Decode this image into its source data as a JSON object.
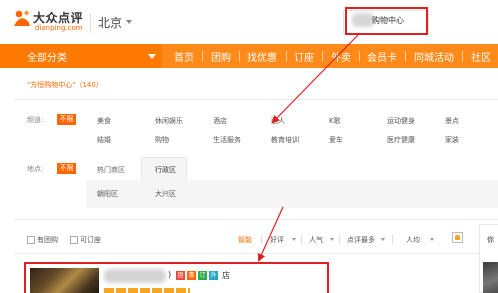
{
  "header": {
    "logo": {
      "name_cn": "大众点评",
      "domain": "dianping.com",
      "icon": "dianping-logo-icon"
    },
    "city": {
      "label": "北京",
      "icon": "chevron-down-icon"
    },
    "search": {
      "value": "购物中心"
    }
  },
  "nav": {
    "all_categories": "全部分类",
    "items": [
      "首页",
      "团购",
      "找优惠",
      "订座",
      "外卖",
      "会员卡",
      "同城活动",
      "社区"
    ]
  },
  "results": {
    "title": "\"方恒购物中心\"（140）"
  },
  "filters": {
    "category": {
      "label": "频道:",
      "all_tag": "不限",
      "row1": [
        "美食",
        "休闲娱乐",
        "酒店",
        "丽人",
        "K歌",
        "运动健身",
        "景点"
      ],
      "row2": [
        "结婚",
        "购物",
        "生活服务",
        "教育培训",
        "爱车",
        "医疗健康",
        "家装"
      ]
    },
    "area": {
      "label": "地点:",
      "all_tag": "不限",
      "tabs": [
        "热门商区",
        "行政区"
      ],
      "districts": [
        "朝阳区",
        "大兴区"
      ]
    }
  },
  "sort_bar": {
    "checkboxes": [
      "有团购",
      "可订座"
    ],
    "options": [
      "智能",
      "好评",
      "人气",
      "点评最多",
      "人均"
    ],
    "active_index": 0,
    "right_panel_label": "你"
  },
  "listing": {
    "name_paren": ")",
    "badges": [
      {
        "label": "团",
        "color": "#e74c3c"
      },
      {
        "label": "惠",
        "color": "#ff6600"
      },
      {
        "label": "订",
        "color": "#2eaa4c"
      },
      {
        "label": "外",
        "color": "#26a7c7"
      }
    ],
    "name_suffix": "店"
  },
  "annotation_colors": {
    "red_box": "#e02020",
    "arrow": "#e02020"
  }
}
